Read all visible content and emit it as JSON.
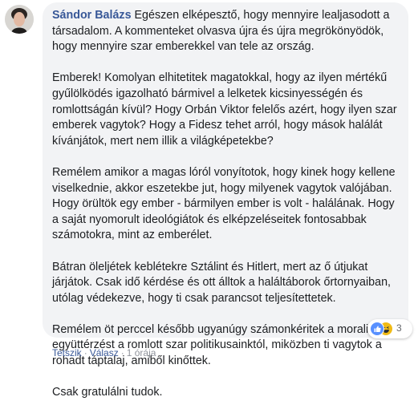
{
  "comment": {
    "author": "Sándor Balázs",
    "first_paragraph": "Egészen elképesztő, hogy mennyire lealjasodott a társadalom. A kommenteket olvasva újra és újra megrökönyödök, hogy mennyire szar emberekkel van tele az ország.",
    "paragraphs": [
      "Emberek! Komolyan elhitetitek magatokkal, hogy az ilyen mértékű gyűlölködés igazolható bármivel a lelketek kicsinyességén és romlottságán kívül? Hogy Orbán Viktor felelős azért, hogy ilyen szar emberek vagytok? Hogy a Fidesz tehet arról, hogy mások halálát kívánjátok, mert nem illik a világképetekbe?",
      "Remélem amikor a magas lóról vonyítotok, hogy kinek hogy kellene viselkednie, akkor eszetekbe jut, hogy milyenek vagytok valójában. Hogy örültök egy ember - bármilyen ember is volt - halálának. Hogy a saját nyomorult ideológiátok és elképzeléseitek fontosabbak számotokra, mint az emberélet.",
      "Bátran öleljétek keblétekre Sztálint és Hitlert, mert az ő útjukat járjátok. Csak idő kérdése és ott álltok a haláltáborok őrtornyaiban, utólag védekezve, hogy ti csak parancsot teljesítettetek.",
      "Remélem öt perccel később ugyanúgy számonkéritek a moralitást és együttérzést a romlott szar politikusainktól, miközben ti vagytok a rohadt táptalaj, amiből kinőttek.",
      "Csak gratulálni tudok."
    ],
    "reactions": {
      "icons": [
        "like-icon",
        "haha-icon"
      ],
      "count": "3"
    },
    "actions": {
      "like": "Tetszik",
      "separator": "·",
      "reply": "Válasz",
      "time": "1 órája"
    }
  }
}
